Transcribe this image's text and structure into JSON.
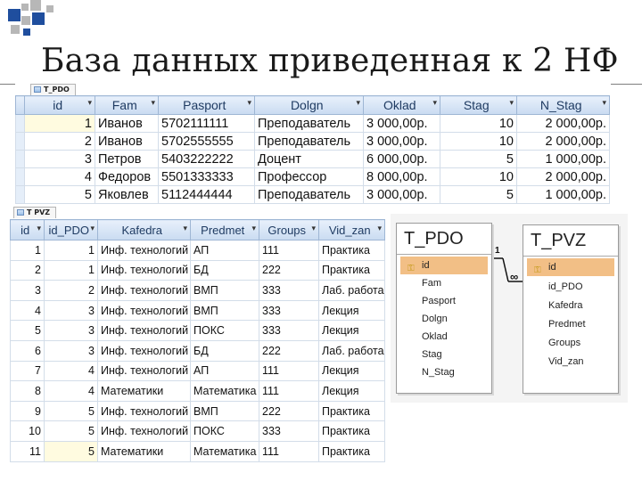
{
  "slide": {
    "title": "База данных приведенная к 2 НФ"
  },
  "t_pdo": {
    "tab_label": "T_PDO",
    "columns": [
      "id",
      "Fam",
      "Pasport",
      "Dolgn",
      "Oklad",
      "Stag",
      "N_Stag"
    ],
    "rows": [
      [
        "1",
        "Иванов",
        "5702111111",
        "Преподаватель",
        "3 000,00р.",
        "10",
        "2 000,00р."
      ],
      [
        "2",
        "Иванов",
        "5702555555",
        "Преподаватель",
        "3 000,00р.",
        "10",
        "2 000,00р."
      ],
      [
        "3",
        "Петров",
        "5403222222",
        "Доцент",
        "6 000,00р.",
        "5",
        "1 000,00р."
      ],
      [
        "4",
        "Федоров",
        "5501333333",
        "Профессор",
        "8 000,00р.",
        "10",
        "2 000,00р."
      ],
      [
        "5",
        "Яковлев",
        "5112444444",
        "Преподаватель",
        "3 000,00р.",
        "5",
        "1 000,00р."
      ]
    ]
  },
  "t_pvz": {
    "tab_label": "T PVZ",
    "columns": [
      "id",
      "id_PDO",
      "Kafedra",
      "Predmet",
      "Groups",
      "Vid_zan"
    ],
    "rows": [
      [
        "1",
        "1",
        "Инф. технологий",
        "АП",
        "111",
        "Практика"
      ],
      [
        "2",
        "1",
        "Инф. технологий",
        "БД",
        "222",
        "Практика"
      ],
      [
        "3",
        "2",
        "Инф. технологий",
        "ВМП",
        "333",
        "Лаб. работа"
      ],
      [
        "4",
        "3",
        "Инф. технологий",
        "ВМП",
        "333",
        "Лекция"
      ],
      [
        "5",
        "3",
        "Инф. технологий",
        "ПОКС",
        "333",
        "Лекция"
      ],
      [
        "6",
        "3",
        "Инф. технологий",
        "БД",
        "222",
        "Лаб. работа"
      ],
      [
        "7",
        "4",
        "Инф. технологий",
        "АП",
        "111",
        "Лекция"
      ],
      [
        "8",
        "4",
        "Математики",
        "Математика",
        "111",
        "Лекция"
      ],
      [
        "9",
        "5",
        "Инф. технологий",
        "ВМП",
        "222",
        "Практика"
      ],
      [
        "10",
        "5",
        "Инф. технологий",
        "ПОКС",
        "333",
        "Практика"
      ],
      [
        "11",
        "5",
        "Математики",
        "Математика",
        "111",
        "Практика"
      ]
    ]
  },
  "diagram": {
    "left_table": {
      "name": "T_PDO",
      "fields": [
        "id",
        "Fam",
        "Pasport",
        "Dolgn",
        "Oklad",
        "Stag",
        "N_Stag"
      ]
    },
    "right_table": {
      "name": "T_PVZ",
      "fields": [
        "id",
        "id_PDO",
        "Kafedra",
        "Predmet",
        "Groups",
        "Vid_zan"
      ]
    },
    "one_label": "1",
    "many_label": "∞"
  },
  "icons": {
    "primary_key": "key-icon",
    "sort_dropdown": "dropdown-arrow-icon",
    "table": "table-icon"
  },
  "colors": {
    "header_bg": "#c9dbf1",
    "pk_highlight": "#f2bf86",
    "selected_cell": "#fffbe0",
    "deco_blue": "#1f4e9e",
    "deco_gray": "#b7b7b7"
  }
}
